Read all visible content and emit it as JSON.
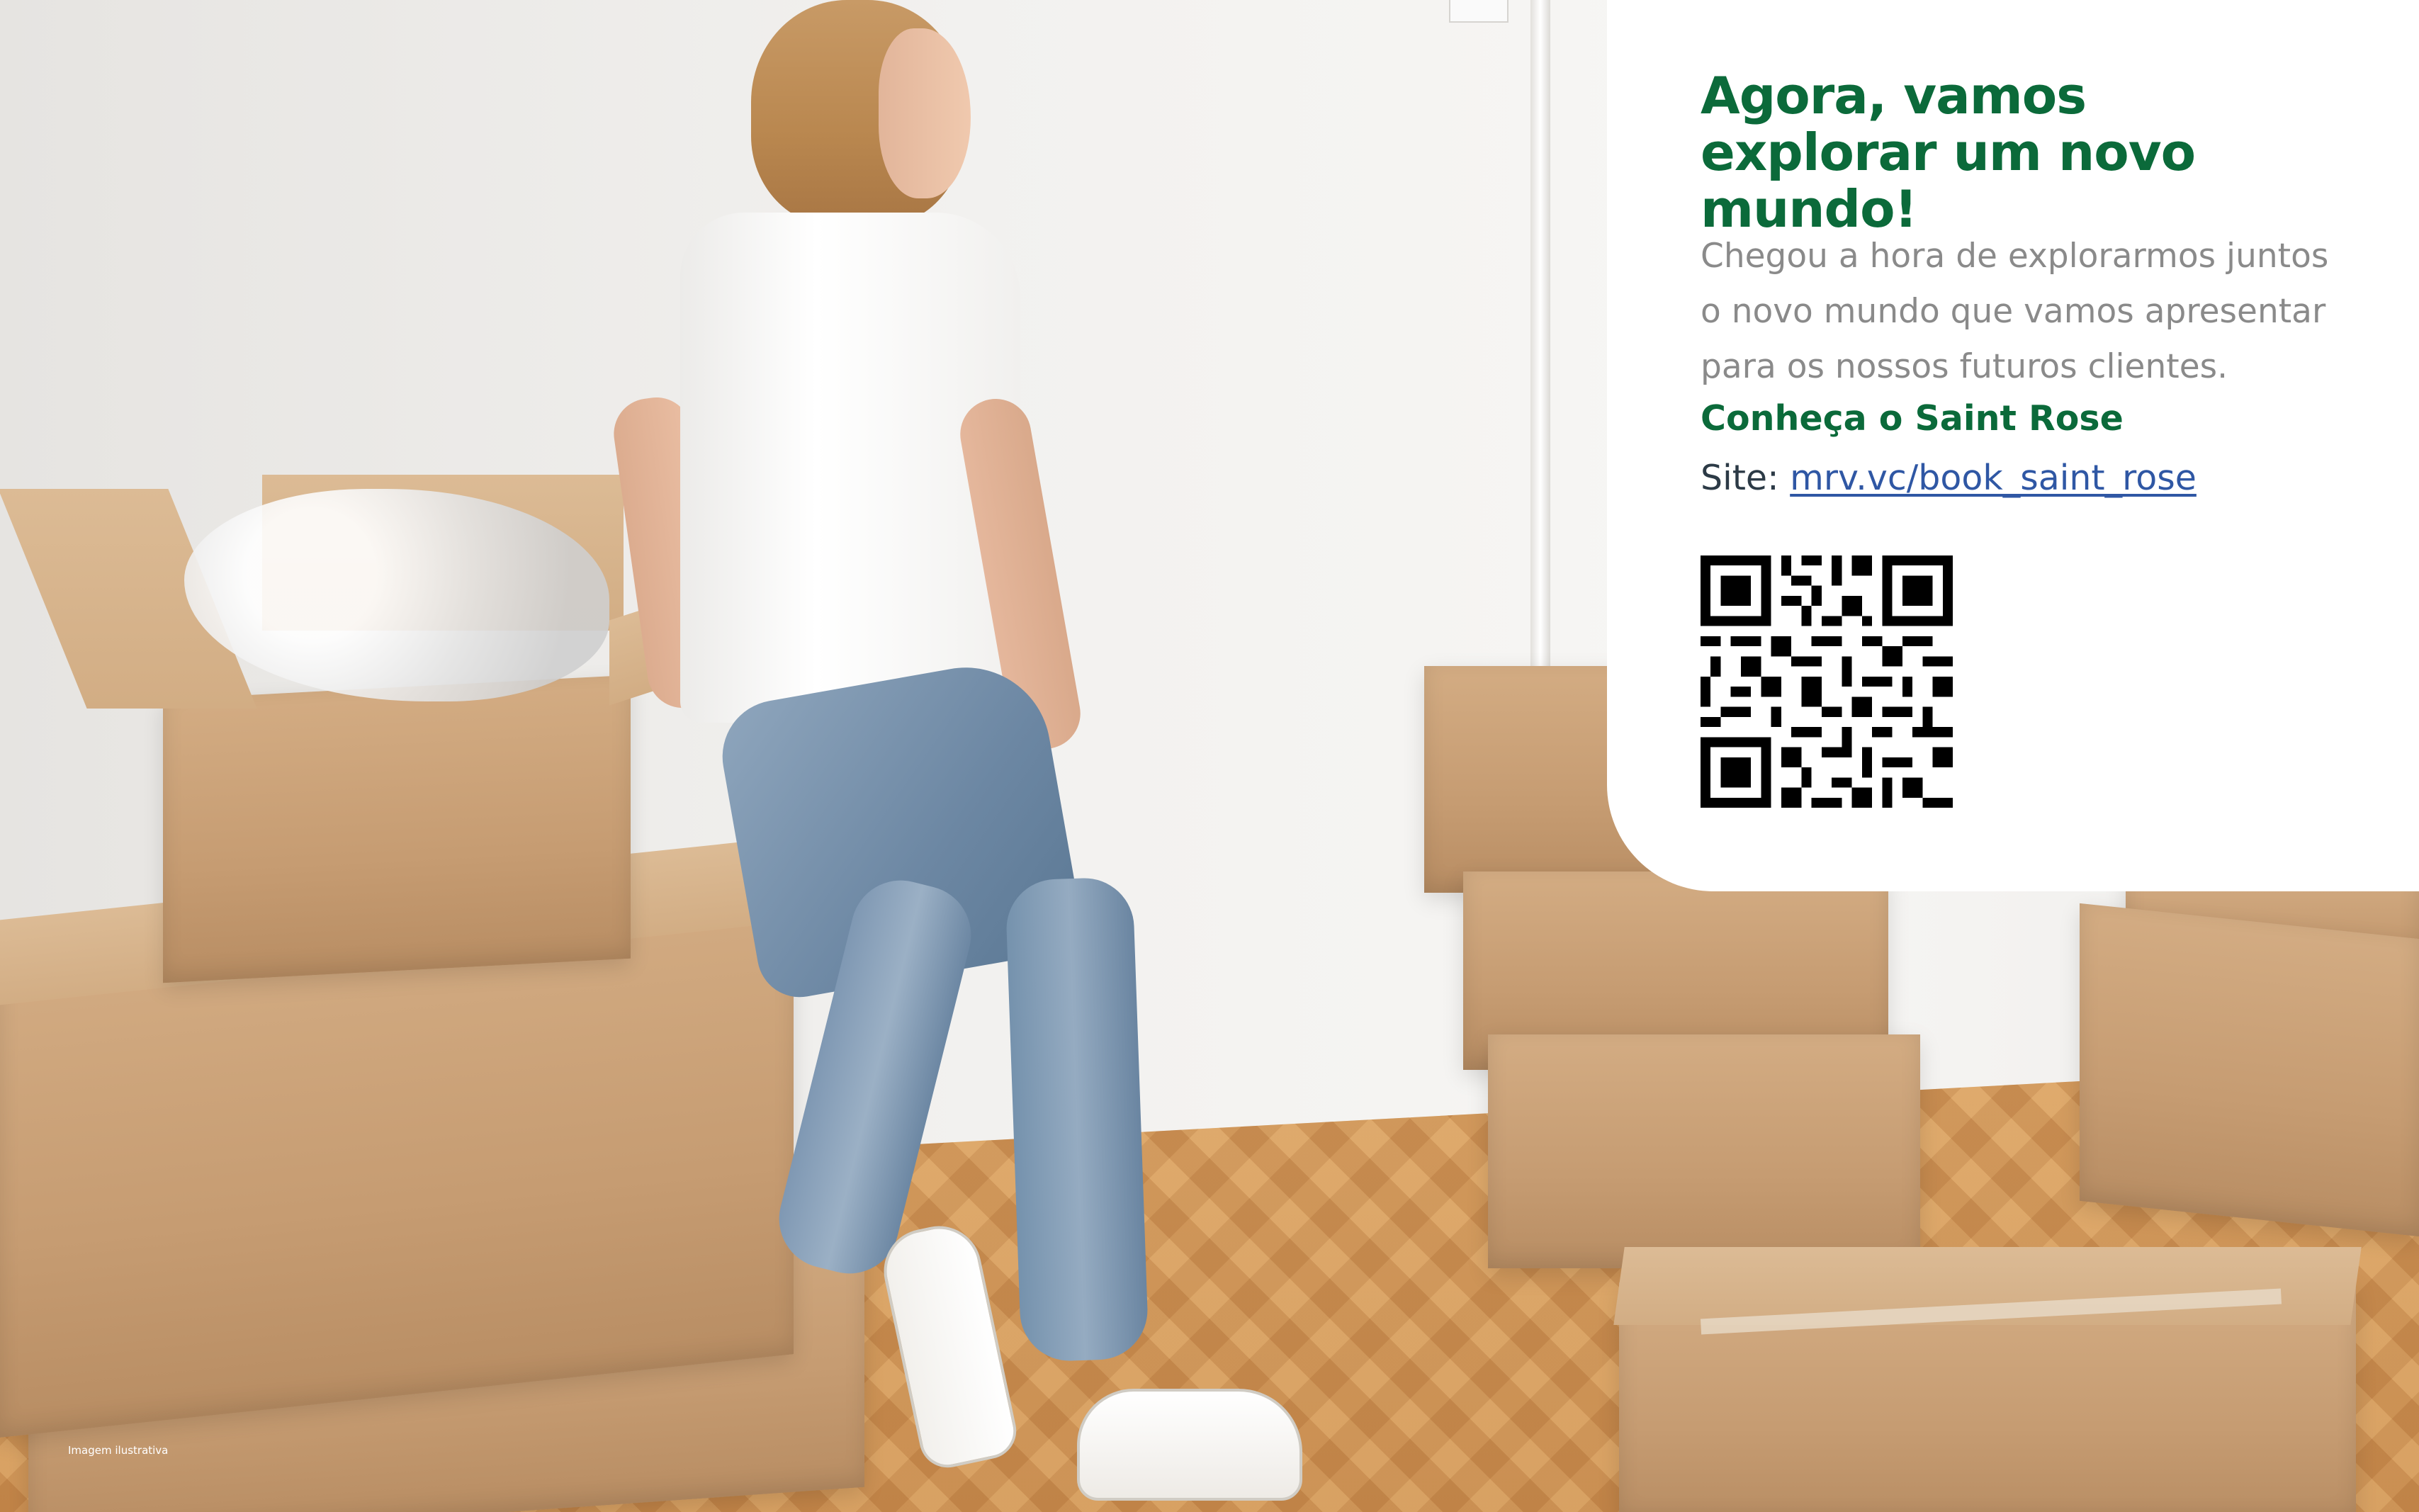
{
  "card": {
    "title": "Agora, vamos explorar um novo mundo!",
    "body": "Chegou a hora de explorarmos juntos\no novo mundo que vamos apresentar\npara os nossos futuros clientes.",
    "cta": "Conheça o Saint Rose",
    "site_label": "Site: ",
    "site_link": "mrv.vc/book_saint_rose"
  },
  "photo": {
    "caption": "Imagem ilustrativa"
  },
  "colors": {
    "brand_green": "#0b6a3a",
    "link_blue": "#2f57a4",
    "body_gray": "#8a8a8a"
  }
}
